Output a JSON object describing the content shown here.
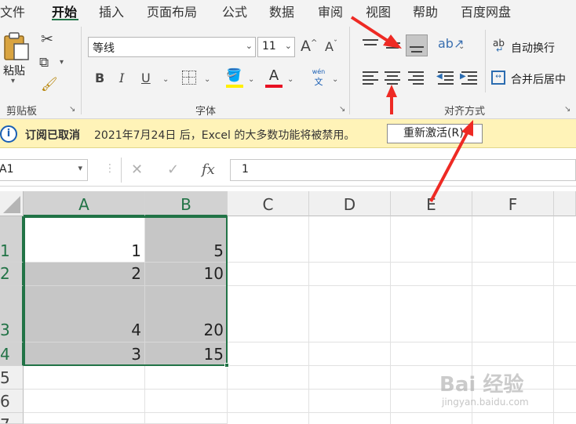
{
  "menu": {
    "items": [
      "文件",
      "开始",
      "插入",
      "页面布局",
      "公式",
      "数据",
      "审阅",
      "视图",
      "帮助",
      "百度网盘"
    ],
    "active_index": 1
  },
  "ribbon": {
    "clipboard": {
      "label": "剪贴板",
      "paste_label": "粘贴"
    },
    "font": {
      "label": "字体",
      "font_name": "等线",
      "font_size": "11",
      "bold": "B",
      "italic": "I",
      "underline": "U",
      "phonetic_top": "wén",
      "phonetic_bottom": "文",
      "font_color": "#e81123",
      "fill_color": "#ffef00"
    },
    "alignment": {
      "label": "对齐方式",
      "wrap_text": "自动换行",
      "merge_center": "合并后居中",
      "wrap_icon_text": "ab",
      "pressed": "align-bottom"
    }
  },
  "notice": {
    "title": "订阅已取消",
    "message": "2021年7月24日 后，Excel 的大多数功能将被禁用。",
    "button": "重新激活(R)"
  },
  "formula_bar": {
    "name_box": "A1",
    "formula": "1",
    "fx": "fx"
  },
  "sheet": {
    "columns": [
      "A",
      "B",
      "C",
      "D",
      "E",
      "F"
    ],
    "rows": [
      {
        "label": "1",
        "A": "1",
        "B": "5"
      },
      {
        "label": "2",
        "A": "2",
        "B": "10"
      },
      {
        "label": "3",
        "A": "4",
        "B": "20"
      },
      {
        "label": "4",
        "A": "3",
        "B": "15"
      },
      {
        "label": "5",
        "A": "",
        "B": ""
      },
      {
        "label": "6",
        "A": "",
        "B": ""
      },
      {
        "label": "7",
        "A": "",
        "B": ""
      }
    ]
  },
  "annotation_color": "#ee2a24",
  "watermark": {
    "main": "Bai 经验",
    "sub": "jingyan.baidu.com"
  }
}
